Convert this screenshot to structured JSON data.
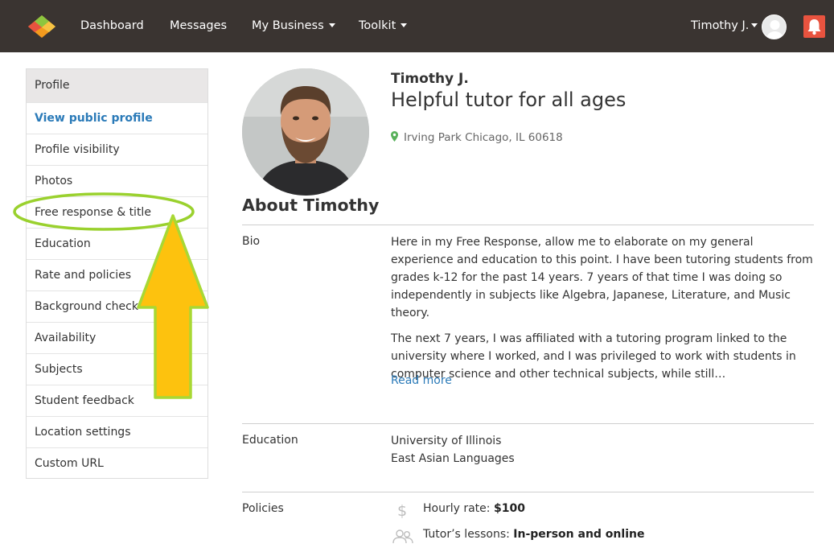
{
  "nav": {
    "items": [
      "Dashboard",
      "Messages",
      "My Business",
      "Toolkit"
    ],
    "user_name": "Timothy J."
  },
  "sidebar": {
    "header": "Profile",
    "items": [
      {
        "label": "View public profile"
      },
      {
        "label": "Profile visibility"
      },
      {
        "label": "Photos"
      },
      {
        "label": "Free response & title"
      },
      {
        "label": "Education"
      },
      {
        "label": "Rate and policies"
      },
      {
        "label": "Background check"
      },
      {
        "label": "Availability"
      },
      {
        "label": "Subjects"
      },
      {
        "label": "Student feedback"
      },
      {
        "label": "Location settings"
      },
      {
        "label": "Custom URL"
      }
    ]
  },
  "profile": {
    "name": "Timothy J.",
    "headline": "Helpful tutor for all ages",
    "location": "Irving Park Chicago, IL 60618",
    "about_heading": "About Timothy"
  },
  "bio": {
    "label": "Bio",
    "paragraphs": [
      "Here in my Free Response, allow me to elaborate on my general experience and education to this point. I have been tutoring students from grades k-12 for the past 14 years. 7 years of that time I was doing so independently in subjects like Algebra, Japanese, Literature, and Music theory.",
      "The next 7 years, I was affiliated with a tutoring program linked to the university where I worked, and I was privileged to work with students in computer science and other technical subjects, while still…"
    ],
    "read_more": "Read more"
  },
  "education": {
    "label": "Education",
    "school": "University of Illinois",
    "major": "East Asian Languages"
  },
  "policies": {
    "label": "Policies",
    "rate_label": "Hourly rate:",
    "rate_value": "$100",
    "lessons_label": "Tutor’s lessons:",
    "lessons_value": "In-person and online"
  },
  "colors": {
    "nav_bg": "#3a3431",
    "link": "#2a7ab8",
    "bell": "#e8533f",
    "annotation_green": "#9ad12e",
    "annotation_arrow": "#fdc20e"
  }
}
